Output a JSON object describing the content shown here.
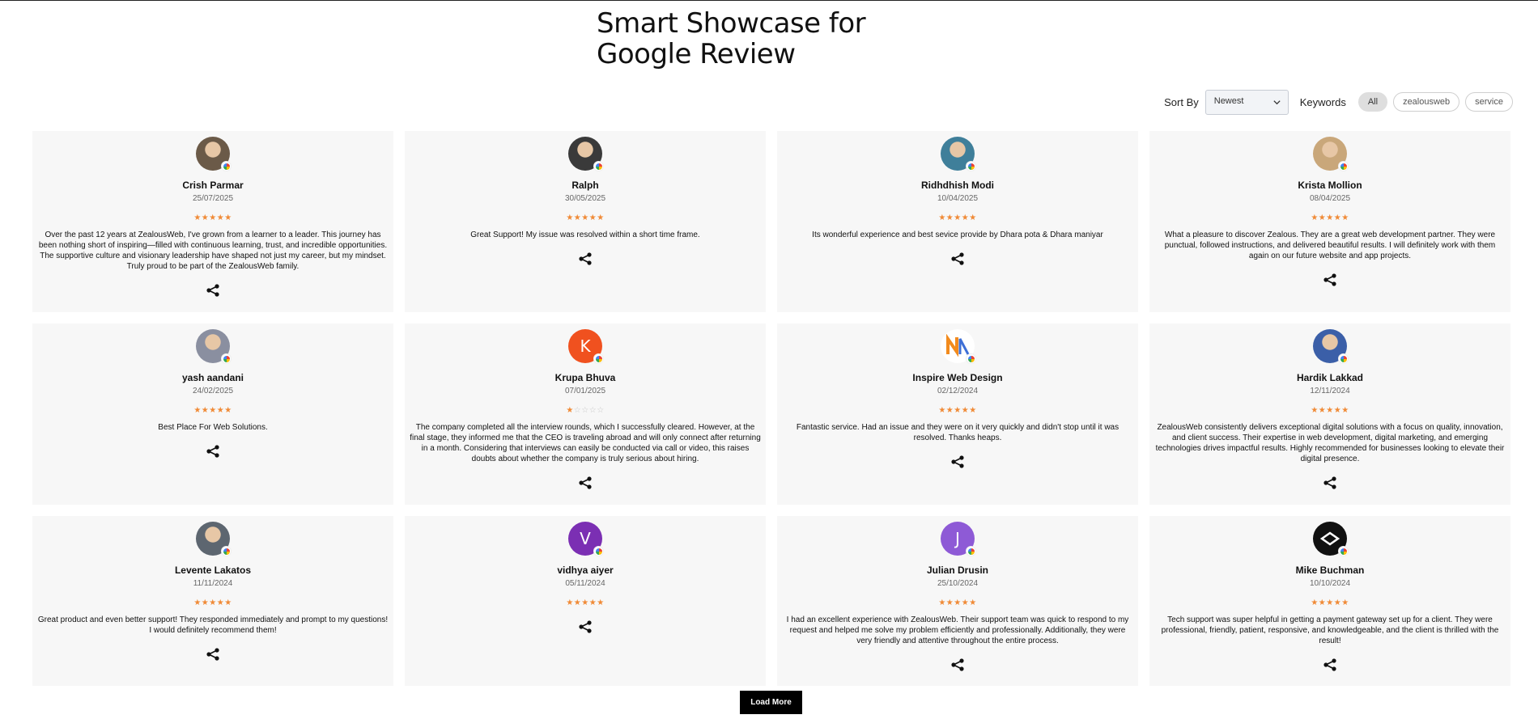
{
  "header": {
    "title_line1": "Smart Showcase for",
    "title_line2": "Google Review"
  },
  "controls": {
    "sort_label": "Sort By",
    "sort_value": "Newest",
    "keywords_label": "Keywords",
    "keywords": [
      "All",
      "zealousweb",
      "service"
    ],
    "active_keyword": "All"
  },
  "colors": {
    "star": "#f08a36",
    "button_bg": "#000000",
    "card_bg": "#f7f7f7"
  },
  "reviews": [
    {
      "name": "Crish Parmar",
      "date": "25/07/2025",
      "rating": 5,
      "text": "Over the past 12 years at ZealousWeb, I've grown from a learner to a leader. This journey has been nothing short of inspiring—filled with continuous learning, trust, and incredible opportunities. The supportive culture and visionary leadership have shaped not just my career, but my mindset. Truly proud to be part of the ZealousWeb family.",
      "avatar": "photo",
      "avatar_color": "#6b5a48"
    },
    {
      "name": "Ralph",
      "date": "30/05/2025",
      "rating": 5,
      "text": "Great Support! My issue was resolved within a short time frame.",
      "avatar": "photo",
      "avatar_color": "#3a3a3a"
    },
    {
      "name": "Ridhdhish Modi",
      "date": "10/04/2025",
      "rating": 5,
      "text": "Its wonderful experience and best sevice provide by Dhara pota & Dhara maniyar",
      "avatar": "photo",
      "avatar_color": "#3f7f9a"
    },
    {
      "name": "Krista Mollion",
      "date": "08/04/2025",
      "rating": 5,
      "text": "What a pleasure to discover Zealous. They are a great web development partner. They were punctual, followed instructions, and delivered beautiful results. I will definitely work with them again on our future website and app projects.",
      "avatar": "photo",
      "avatar_color": "#c9a77a"
    },
    {
      "name": "yash aandani",
      "date": "24/02/2025",
      "rating": 5,
      "text": "Best Place For Web Solutions.",
      "avatar": "photo",
      "avatar_color": "#8a8fa0"
    },
    {
      "name": "Krupa Bhuva",
      "date": "07/01/2025",
      "rating": 1,
      "text": "The company completed all the interview rounds, which I successfully cleared. However, at the final stage, they informed me that the CEO is traveling abroad and will only connect after returning in a month. Considering that interviews can easily be conducted via call or video, this raises doubts about whether the company is truly serious about hiring.",
      "avatar": "letter",
      "avatar_letter": "K",
      "avatar_color": "#f0511f"
    },
    {
      "name": "Inspire Web Design",
      "date": "02/12/2024",
      "rating": 5,
      "text": "Fantastic service. Had an issue and they were on it very quickly and didn't stop until it was resolved. Thanks heaps.",
      "avatar": "logo",
      "avatar_color": "#f28b1e"
    },
    {
      "name": "Hardik Lakkad",
      "date": "12/11/2024",
      "rating": 5,
      "text": "ZealousWeb consistently delivers exceptional digital solutions with a focus on quality, innovation, and client success. Their expertise in web development, digital marketing, and emerging technologies drives impactful results. Highly recommended for businesses looking to elevate their digital presence.",
      "avatar": "photo",
      "avatar_color": "#3b5fa8"
    },
    {
      "name": "Levente Lakatos",
      "date": "11/11/2024",
      "rating": 5,
      "text": "Great product and even better support! They responded immediately and prompt to my questions! I would definitely recommend them!",
      "avatar": "photo",
      "avatar_color": "#5d6670"
    },
    {
      "name": "vidhya aiyer",
      "date": "05/11/2024",
      "rating": 5,
      "text": "",
      "avatar": "letter",
      "avatar_letter": "V",
      "avatar_color": "#7b2fb3"
    },
    {
      "name": "Julian Drusin",
      "date": "25/10/2024",
      "rating": 5,
      "text": "I had an excellent experience with ZealousWeb. Their support team was quick to respond to my request and helped me solve my problem efficiently and professionally. Additionally, they were very friendly and attentive throughout the entire process.",
      "avatar": "letter",
      "avatar_letter": "J",
      "avatar_color": "#8e5ad6"
    },
    {
      "name": "Mike Buchman",
      "date": "10/10/2024",
      "rating": 5,
      "text": "Tech support was super helpful in getting a payment gateway set up for a client. They were professional, friendly, patient, responsive, and knowledgeable, and the client is thrilled with the result!",
      "avatar": "logo",
      "avatar_color": "#111111"
    }
  ],
  "footer": {
    "load_more": "Load More"
  }
}
